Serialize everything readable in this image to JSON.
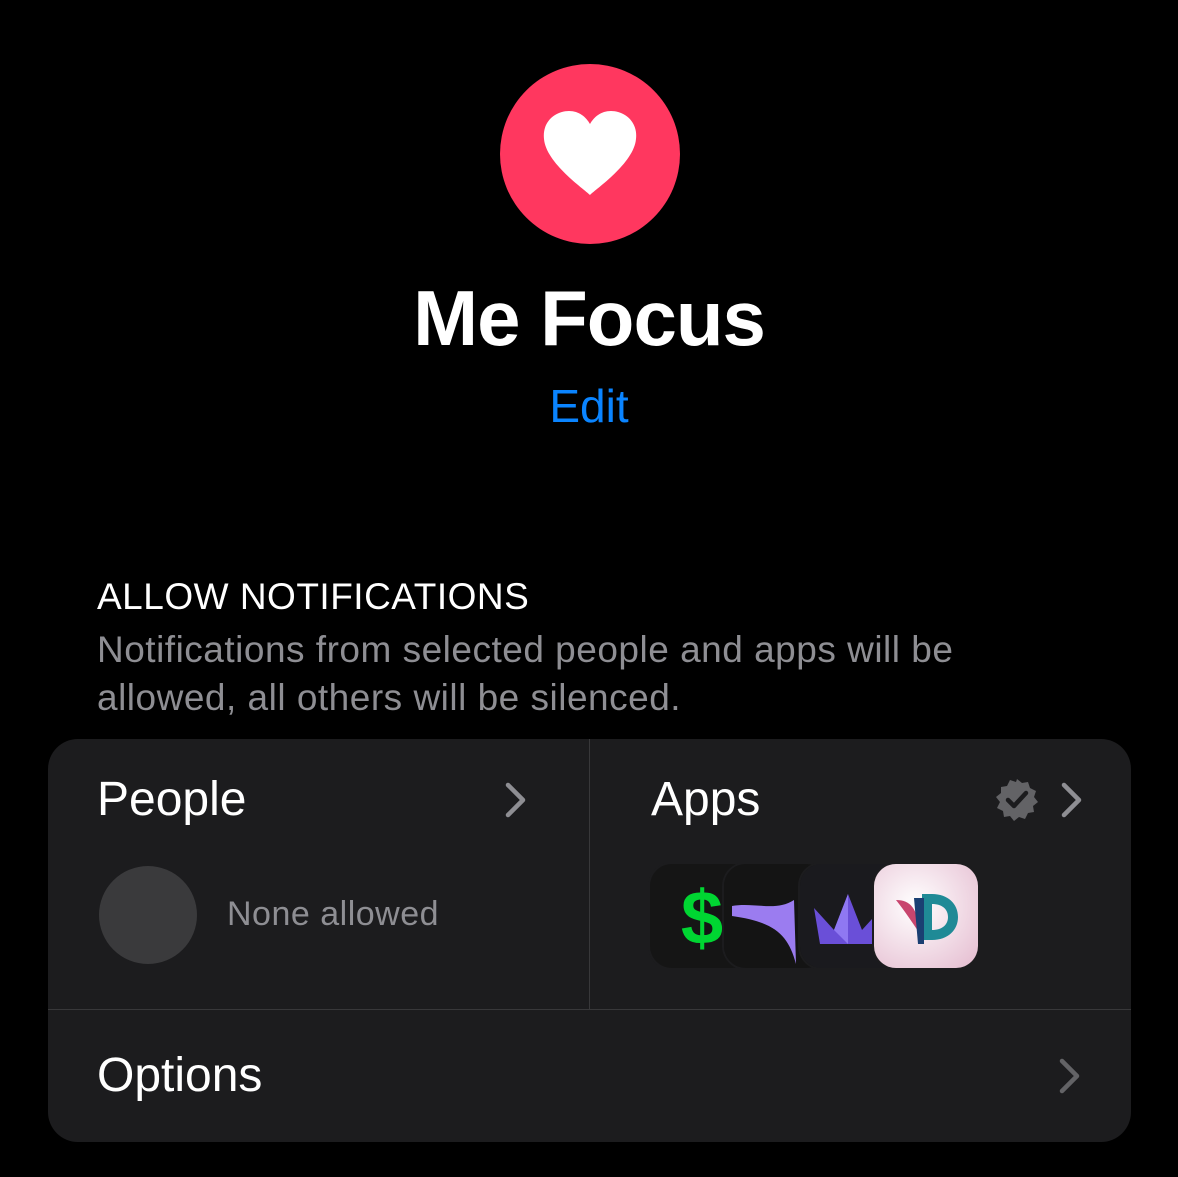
{
  "focus": {
    "icon": "heart-icon",
    "icon_color": "#ff375f",
    "title": "Me Focus",
    "edit_label": "Edit"
  },
  "allow_notifications": {
    "header": "ALLOW NOTIFICATIONS",
    "description": "Notifications from selected people and apps will be allowed, all others will be silenced."
  },
  "people": {
    "label": "People",
    "status": "None allowed"
  },
  "apps": {
    "label": "Apps",
    "badge_icon": "verified-badge-icon",
    "icons": [
      "cash-app-icon",
      "purple-app-icon",
      "crown-app-icon",
      "day-one-app-icon"
    ]
  },
  "options": {
    "label": "Options"
  },
  "colors": {
    "background": "#000000",
    "card": "#1c1c1e",
    "accent": "#0a84ff",
    "secondary_text": "#8e8e93"
  }
}
